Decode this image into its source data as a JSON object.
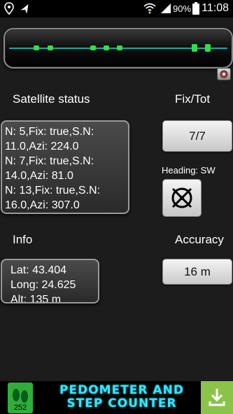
{
  "status_bar": {
    "battery": "90%",
    "time": "11:08"
  },
  "signal_bar": {
    "satellites": [
      {
        "id": 1,
        "pos": 0.125,
        "tall": false
      },
      {
        "id": 2,
        "pos": 0.19,
        "tall": false
      },
      {
        "id": 3,
        "pos": 0.385,
        "tall": false
      },
      {
        "id": 4,
        "pos": 0.445,
        "tall": false
      },
      {
        "id": 5,
        "pos": 0.505,
        "tall": false
      },
      {
        "id": 6,
        "pos": 0.85,
        "tall": true
      },
      {
        "id": 7,
        "pos": 0.91,
        "tall": true
      }
    ],
    "line_color": "#1aa9a3",
    "dot_color": "#2ee046"
  },
  "sections": {
    "satellite_status": "Satellite status",
    "fix_tot": "Fix/Tot",
    "heading": "Heading: SW",
    "info": "Info",
    "accuracy": "Accuracy"
  },
  "satellite_list": [
    "N: 5,Fix: true,S.N:",
    "11.0,Azi: 224.0",
    "N: 7,Fix: true,S.N:",
    "14.0,Azi: 81.0",
    "N: 13,Fix: true,S.N:",
    "16.0,Azi: 307.0"
  ],
  "fix_tot_value": "7/7",
  "info_list": [
    "Lat: 43.404",
    "Long: 24.625",
    "Alt: 135 m"
  ],
  "accuracy_value": "16 m",
  "ad": {
    "title_line1": "PEDOMETER AND",
    "title_line2": "STEP COUNTER",
    "thumb_number": "252"
  },
  "icons": [
    "gps-icon",
    "wifi-icon",
    "signal-icon",
    "battery-icon",
    "compass-icon",
    "download-icon",
    "settings-icon"
  ]
}
